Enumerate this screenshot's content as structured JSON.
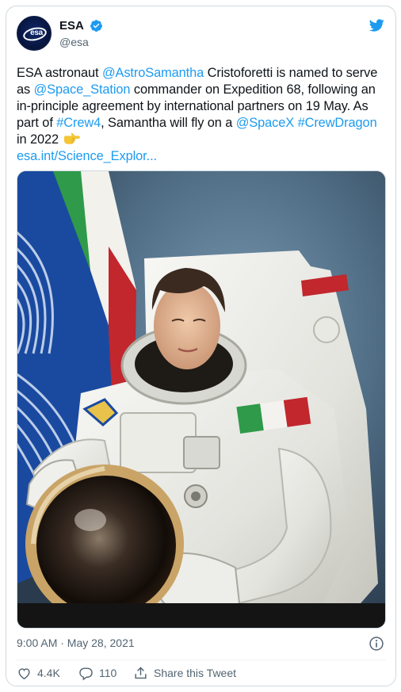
{
  "account": {
    "name": "ESA",
    "handle": "@esa",
    "avatar_logo_text": "esa"
  },
  "tweet": {
    "seg1": "ESA astronaut ",
    "mention1": "@AstroSamantha",
    "seg2": " Cristoforetti is named to serve as ",
    "mention2": "@Space_Station",
    "seg3": " commander on Expedition 68, following an in-principle agreement by international partners on 19 May. As part of ",
    "hashtag1": "#Crew4",
    "seg4": ", Samantha will fly on a ",
    "mention3": "@SpaceX",
    "seg5": " ",
    "hashtag2": "#CrewDragon",
    "seg6": " in 2022 ",
    "link": "esa.int/Science_Explor..."
  },
  "meta": {
    "timestamp": "9:00 AM · May 28, 2021"
  },
  "actions": {
    "like_count": "4.4K",
    "reply_count": "110",
    "share_label": "Share this Tweet"
  },
  "colors": {
    "link": "#1d9bf0",
    "text": "#0f1419",
    "muted": "#536471",
    "border": "#cfd9de"
  },
  "icons": [
    "esa-logo-icon",
    "verified-badge-icon",
    "twitter-bird-icon",
    "pointing-hand-emoji",
    "info-icon",
    "heart-icon",
    "reply-icon",
    "share-icon"
  ]
}
